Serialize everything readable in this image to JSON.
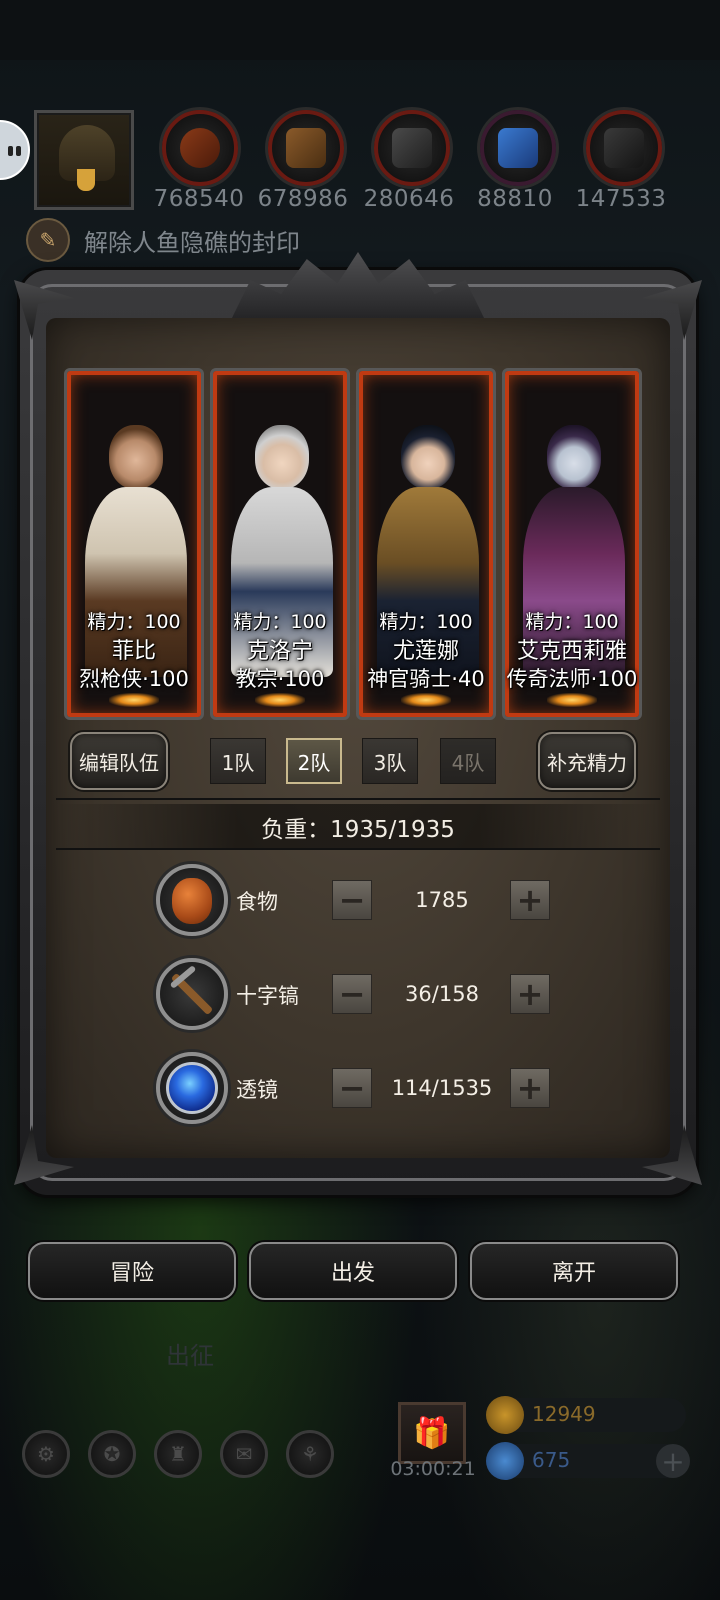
{
  "top_bar": {
    "resources": [
      {
        "icon": "meat-icon",
        "value": "768540"
      },
      {
        "icon": "wood-icon",
        "value": "678986"
      },
      {
        "icon": "iron-icon",
        "value": "280646"
      },
      {
        "icon": "crystal-icon",
        "value": "88810"
      },
      {
        "icon": "stone-icon",
        "value": "147533"
      }
    ]
  },
  "quest": {
    "text": "解除人鱼隐礁的封印"
  },
  "party": {
    "characters": [
      {
        "energy": "精力：100",
        "name": "菲比",
        "class_level": "烈枪侠·100"
      },
      {
        "energy": "精力：100",
        "name": "克洛宁",
        "class_level": "教宗·100"
      },
      {
        "energy": "精力：100",
        "name": "尤莲娜",
        "class_level": "神官骑士·40"
      },
      {
        "energy": "精力：100",
        "name": "艾克西莉雅",
        "class_level": "传奇法师·100"
      }
    ],
    "edit_team_label": "编辑队伍",
    "teams": [
      "1队",
      "2队",
      "3队",
      "4队"
    ],
    "active_team": "2队",
    "refill_energy_label": "补充精力"
  },
  "load": {
    "text": "负重：1935/1935"
  },
  "supplies": [
    {
      "label": "食物",
      "value": "1785",
      "icon": "meat-icon"
    },
    {
      "label": "十字镐",
      "value": "36/158",
      "icon": "pickaxe-icon"
    },
    {
      "label": "透镜",
      "value": "114/1535",
      "icon": "lens-icon"
    }
  ],
  "stepper": {
    "minus": "−",
    "plus": "+"
  },
  "actions": {
    "adventure": "冒险",
    "depart": "出发",
    "leave": "离开"
  },
  "background": {
    "expedition_label": "出征"
  },
  "hud": {
    "timer": "03:00:21",
    "gold": "12949",
    "gems": "675"
  },
  "colors": {
    "card_glow": "#c03a12",
    "gold_text": "#8a6a2a",
    "gem_text": "#3a5a8a"
  }
}
